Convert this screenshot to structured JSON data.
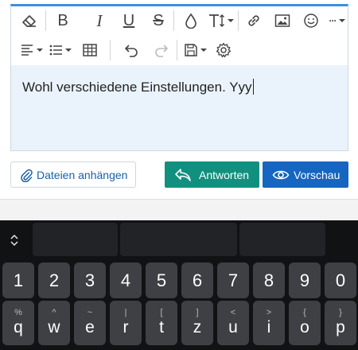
{
  "editor": {
    "toolbar": {
      "row1": [
        "eraser-icon",
        "bold-icon",
        "italic-icon",
        "underline-icon",
        "strikethrough-icon",
        "color-drop-icon",
        "font-size-icon",
        "link-icon",
        "image-icon",
        "emoji-icon",
        "more-icon"
      ],
      "row2": [
        "align-icon",
        "list-icon",
        "table-icon",
        "undo-icon",
        "redo-icon",
        "save-icon",
        "settings-icon"
      ],
      "labels": {
        "bold": "B",
        "italic": "I",
        "underline": "U",
        "strike": "S",
        "more": "···"
      }
    },
    "text": "Wohl verschiedene Einstellungen. Yyy"
  },
  "actions": {
    "attach_label": "Dateien anhängen",
    "reply_label": "Antworten",
    "preview_label": "Vorschau"
  },
  "colors": {
    "accent_blue": "#1665c0",
    "reply_green": "#11907f",
    "toolbar_top": "#3d8fe0",
    "keyboard_bg": "#111214",
    "key_bg": "#3f4044"
  },
  "keyboard": {
    "number_row": [
      "1",
      "2",
      "3",
      "4",
      "5",
      "6",
      "7",
      "8",
      "9",
      "0"
    ],
    "letter_row": [
      {
        "sub": "%",
        "main": "q"
      },
      {
        "sub": "^",
        "main": "w"
      },
      {
        "sub": "~",
        "main": "e"
      },
      {
        "sub": "|",
        "main": "r"
      },
      {
        "sub": "[",
        "main": "t"
      },
      {
        "sub": "]",
        "main": "z"
      },
      {
        "sub": "<",
        "main": "u"
      },
      {
        "sub": ">",
        "main": "i"
      },
      {
        "sub": "{",
        "main": "o"
      },
      {
        "sub": "}",
        "main": "p"
      }
    ]
  }
}
